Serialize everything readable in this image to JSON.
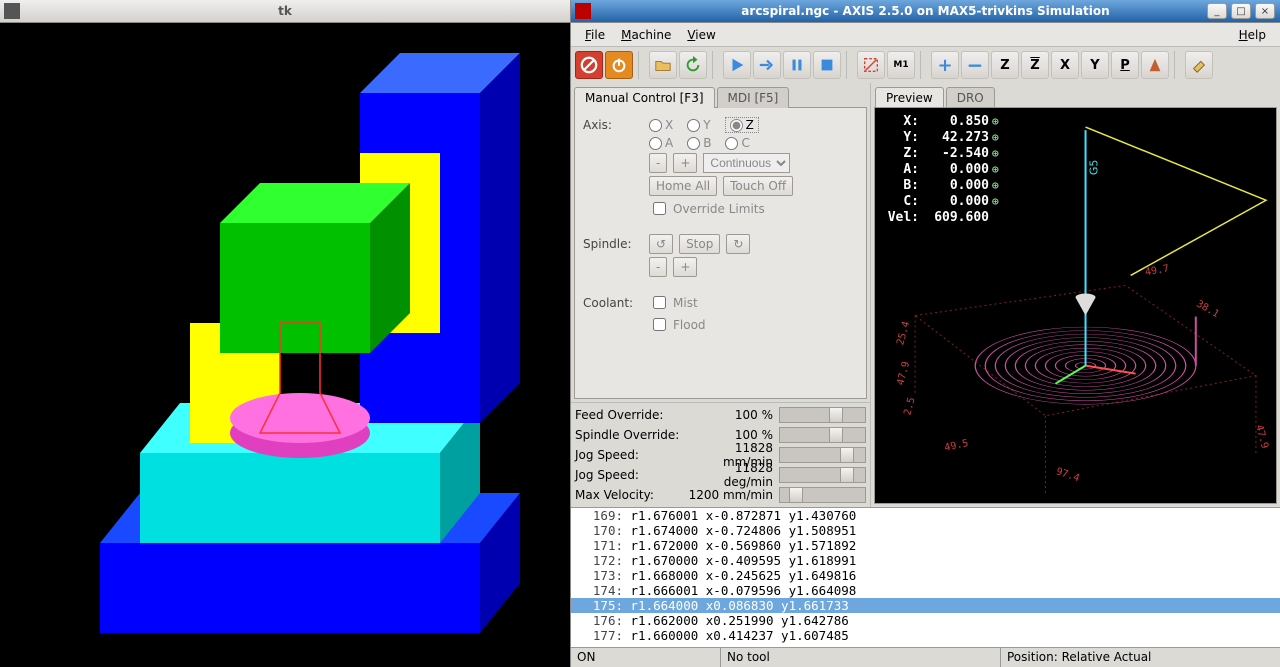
{
  "left_window": {
    "title": "tk"
  },
  "right_window": {
    "title": "arcspiral.ngc - AXIS 2.5.0 on MAX5-trivkins Simulation"
  },
  "menu": {
    "file": "File",
    "machine": "Machine",
    "view": "View",
    "help": "Help"
  },
  "toolbar": {
    "estop": "⏻",
    "power": "⏼",
    "z": "Z",
    "zn": "Z",
    "x": "X",
    "y": "Y",
    "p": "P"
  },
  "tabs": {
    "manual": "Manual Control [F3]",
    "mdi": "MDI [F5]",
    "preview": "Preview",
    "dro": "DRO"
  },
  "manual": {
    "axis_label": "Axis:",
    "axes": {
      "x": "X",
      "y": "Y",
      "z": "Z",
      "a": "A",
      "b": "B",
      "c": "C"
    },
    "minus": "-",
    "plus": "+",
    "continuous": "Continuous",
    "home_all": "Home All",
    "touch_off": "Touch Off",
    "override_limits": "Override Limits",
    "spindle_label": "Spindle:",
    "stop": "Stop",
    "coolant_label": "Coolant:",
    "mist": "Mist",
    "flood": "Flood"
  },
  "overrides": {
    "feed": {
      "label": "Feed Override:",
      "value": "100 %"
    },
    "spindle": {
      "label": "Spindle Override:",
      "value": "100 %"
    },
    "jog_mm": {
      "label": "Jog Speed:",
      "value": "11828 mm/min"
    },
    "jog_deg": {
      "label": "Jog Speed:",
      "value": "11828 deg/min"
    },
    "maxvel": {
      "label": "Max Velocity:",
      "value": "1200 mm/min"
    }
  },
  "dro": {
    "x": {
      "label": "X:",
      "value": "0.850"
    },
    "y": {
      "label": "Y:",
      "value": "42.273"
    },
    "z": {
      "label": "Z:",
      "value": "-2.540"
    },
    "a": {
      "label": "A:",
      "value": "0.000"
    },
    "b": {
      "label": "B:",
      "value": "0.000"
    },
    "c": {
      "label": "C:",
      "value": "0.000"
    },
    "vel": {
      "label": "Vel:",
      "value": "609.600"
    }
  },
  "preview": {
    "dims": {
      "a": "49.5",
      "b": "25.4",
      "c": "97.4",
      "d": "47.9",
      "e": "47.9",
      "f": "2.5",
      "g": "49.7",
      "h": "38.1"
    },
    "g5": "G5"
  },
  "gcode": [
    {
      "n": "169",
      "t": "r1.676001 x-0.872871 y1.430760"
    },
    {
      "n": "170",
      "t": "r1.674000 x-0.724806 y1.508951"
    },
    {
      "n": "171",
      "t": "r1.672000 x-0.569860 y1.571892"
    },
    {
      "n": "172",
      "t": "r1.670000 x-0.409595 y1.618991"
    },
    {
      "n": "173",
      "t": "r1.668000 x-0.245625 y1.649816"
    },
    {
      "n": "174",
      "t": "r1.666001 x-0.079596 y1.664098"
    },
    {
      "n": "175",
      "t": "r1.664000 x0.086830 y1.661733",
      "sel": true
    },
    {
      "n": "176",
      "t": "r1.662000 x0.251990 y1.642786"
    },
    {
      "n": "177",
      "t": "r1.660000 x0.414237 y1.607485"
    }
  ],
  "status": {
    "on": "ON",
    "tool": "No tool",
    "position": "Position: Relative Actual"
  }
}
